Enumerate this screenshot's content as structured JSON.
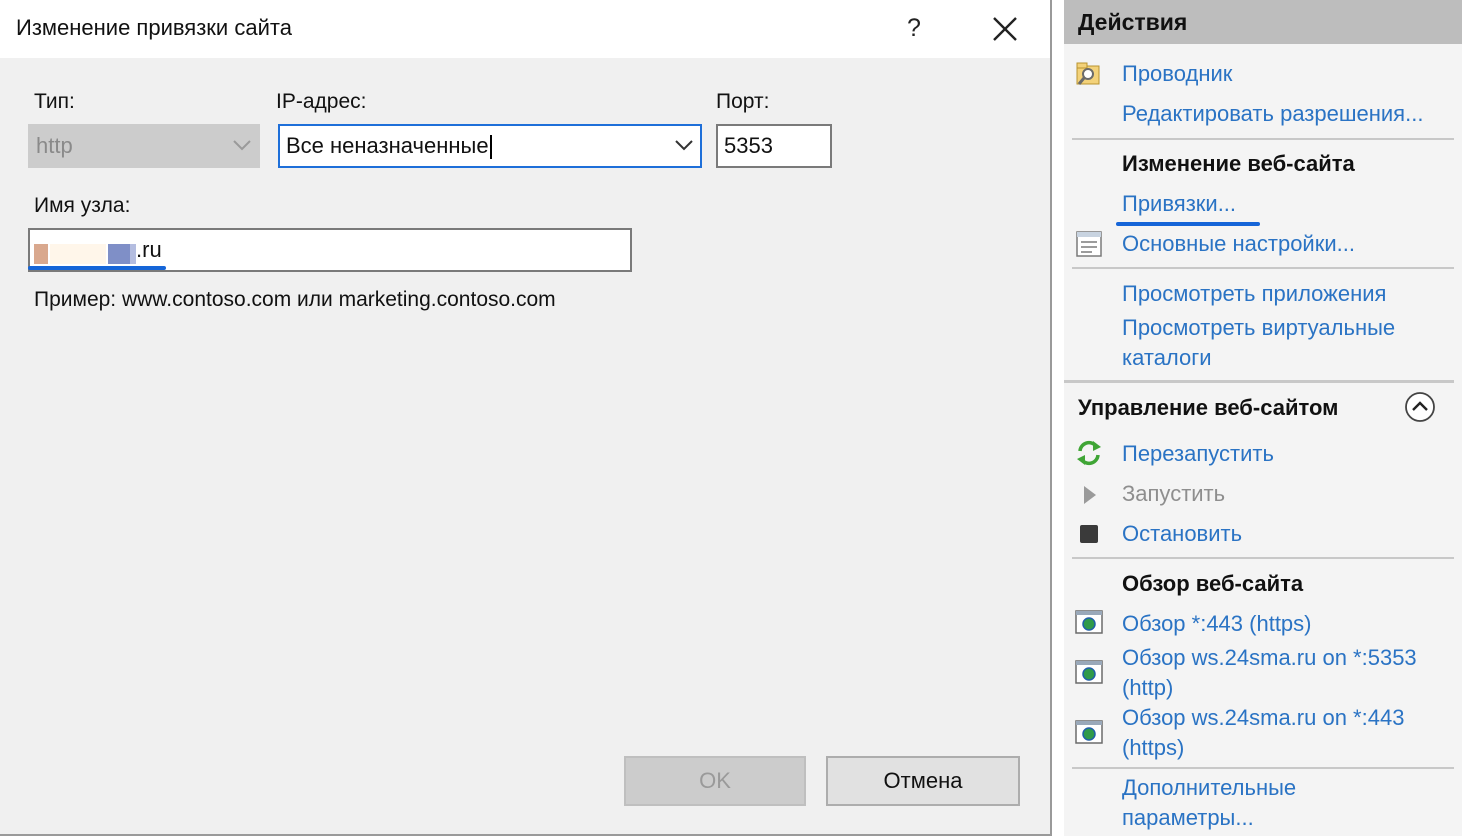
{
  "dialog": {
    "title": "Изменение привязки сайта",
    "help_label": "?",
    "type_label": "Тип:",
    "type_value": "http",
    "ip_label": "IP-адрес:",
    "ip_value": "Все неназначенные",
    "port_label": "Порт:",
    "port_value": "5353",
    "host_label": "Имя узла:",
    "host_value_visible_suffix": ".ru",
    "example_text": "Пример: www.contoso.com или marketing.contoso.com",
    "ok_label": "OK",
    "cancel_label": "Отмена"
  },
  "actions": {
    "title": "Действия",
    "explorer": "Проводник",
    "edit_permissions": "Редактировать разрешения...",
    "edit_site_header": "Изменение веб-сайта",
    "bindings": "Привязки...",
    "basic_settings": "Основные настройки...",
    "view_apps": "Просмотреть приложения",
    "view_vdirs_line1": "Просмотреть виртуальные",
    "view_vdirs_line2": "каталоги",
    "manage_header": "Управление веб-сайтом",
    "restart": "Перезапустить",
    "start": "Запустить",
    "stop": "Остановить",
    "browse_header": "Обзор веб-сайта",
    "browse1": "Обзор *:443 (https)",
    "browse2_line1": "Обзор ws.24sma.ru on *:5353",
    "browse2_line2": "(http)",
    "browse3_line1": "Обзор ws.24sma.ru on *:443",
    "browse3_line2": "(https)",
    "advanced_line1": "Дополнительные",
    "advanced_line2": "параметры..."
  },
  "colors": {
    "link": "#2a73c4",
    "accent_underline": "#1565d8",
    "focus_border": "#1e6fd9",
    "header_bg": "#bdbdbd",
    "dialog_bg": "#f0f0f0"
  },
  "icons": [
    "close-icon",
    "chevron-down-icon",
    "explorer-icon",
    "settings-icon",
    "collapse-up-icon",
    "restart-icon",
    "start-icon",
    "stop-icon",
    "browse-icon"
  ]
}
